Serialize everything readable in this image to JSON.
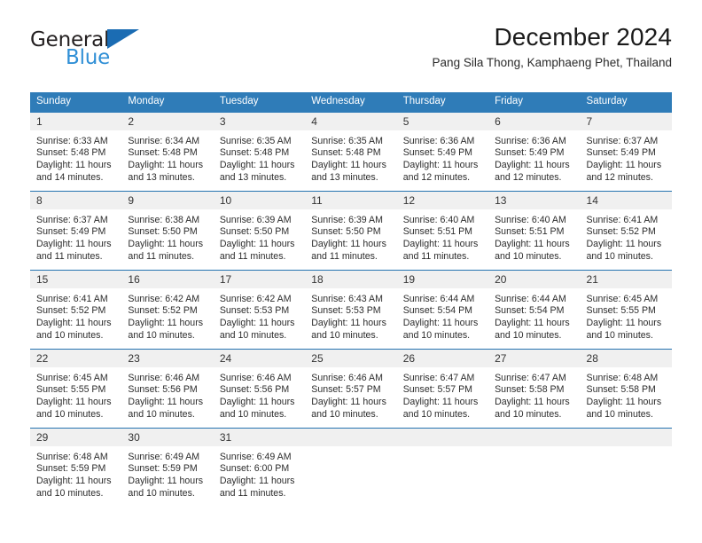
{
  "brand": {
    "name_part1": "General",
    "name_part2": "Blue",
    "triangle_color": "#1b6cb3",
    "blue_text_color": "#2f8fd6"
  },
  "header": {
    "title": "December 2024",
    "subtitle": "Pang Sila Thong, Kamphaeng Phet, Thailand"
  },
  "theme": {
    "header_blue": "#2f7cb8",
    "separator_blue": "#2573b0",
    "daynum_band": "#f0f0f0"
  },
  "weekdays": [
    "Sunday",
    "Monday",
    "Tuesday",
    "Wednesday",
    "Thursday",
    "Friday",
    "Saturday"
  ],
  "weeks": [
    [
      {
        "day": "1",
        "sunrise": "Sunrise: 6:33 AM",
        "sunset": "Sunset: 5:48 PM",
        "daylight": "Daylight: 11 hours and 14 minutes."
      },
      {
        "day": "2",
        "sunrise": "Sunrise: 6:34 AM",
        "sunset": "Sunset: 5:48 PM",
        "daylight": "Daylight: 11 hours and 13 minutes."
      },
      {
        "day": "3",
        "sunrise": "Sunrise: 6:35 AM",
        "sunset": "Sunset: 5:48 PM",
        "daylight": "Daylight: 11 hours and 13 minutes."
      },
      {
        "day": "4",
        "sunrise": "Sunrise: 6:35 AM",
        "sunset": "Sunset: 5:48 PM",
        "daylight": "Daylight: 11 hours and 13 minutes."
      },
      {
        "day": "5",
        "sunrise": "Sunrise: 6:36 AM",
        "sunset": "Sunset: 5:49 PM",
        "daylight": "Daylight: 11 hours and 12 minutes."
      },
      {
        "day": "6",
        "sunrise": "Sunrise: 6:36 AM",
        "sunset": "Sunset: 5:49 PM",
        "daylight": "Daylight: 11 hours and 12 minutes."
      },
      {
        "day": "7",
        "sunrise": "Sunrise: 6:37 AM",
        "sunset": "Sunset: 5:49 PM",
        "daylight": "Daylight: 11 hours and 12 minutes."
      }
    ],
    [
      {
        "day": "8",
        "sunrise": "Sunrise: 6:37 AM",
        "sunset": "Sunset: 5:49 PM",
        "daylight": "Daylight: 11 hours and 11 minutes."
      },
      {
        "day": "9",
        "sunrise": "Sunrise: 6:38 AM",
        "sunset": "Sunset: 5:50 PM",
        "daylight": "Daylight: 11 hours and 11 minutes."
      },
      {
        "day": "10",
        "sunrise": "Sunrise: 6:39 AM",
        "sunset": "Sunset: 5:50 PM",
        "daylight": "Daylight: 11 hours and 11 minutes."
      },
      {
        "day": "11",
        "sunrise": "Sunrise: 6:39 AM",
        "sunset": "Sunset: 5:50 PM",
        "daylight": "Daylight: 11 hours and 11 minutes."
      },
      {
        "day": "12",
        "sunrise": "Sunrise: 6:40 AM",
        "sunset": "Sunset: 5:51 PM",
        "daylight": "Daylight: 11 hours and 11 minutes."
      },
      {
        "day": "13",
        "sunrise": "Sunrise: 6:40 AM",
        "sunset": "Sunset: 5:51 PM",
        "daylight": "Daylight: 11 hours and 10 minutes."
      },
      {
        "day": "14",
        "sunrise": "Sunrise: 6:41 AM",
        "sunset": "Sunset: 5:52 PM",
        "daylight": "Daylight: 11 hours and 10 minutes."
      }
    ],
    [
      {
        "day": "15",
        "sunrise": "Sunrise: 6:41 AM",
        "sunset": "Sunset: 5:52 PM",
        "daylight": "Daylight: 11 hours and 10 minutes."
      },
      {
        "day": "16",
        "sunrise": "Sunrise: 6:42 AM",
        "sunset": "Sunset: 5:52 PM",
        "daylight": "Daylight: 11 hours and 10 minutes."
      },
      {
        "day": "17",
        "sunrise": "Sunrise: 6:42 AM",
        "sunset": "Sunset: 5:53 PM",
        "daylight": "Daylight: 11 hours and 10 minutes."
      },
      {
        "day": "18",
        "sunrise": "Sunrise: 6:43 AM",
        "sunset": "Sunset: 5:53 PM",
        "daylight": "Daylight: 11 hours and 10 minutes."
      },
      {
        "day": "19",
        "sunrise": "Sunrise: 6:44 AM",
        "sunset": "Sunset: 5:54 PM",
        "daylight": "Daylight: 11 hours and 10 minutes."
      },
      {
        "day": "20",
        "sunrise": "Sunrise: 6:44 AM",
        "sunset": "Sunset: 5:54 PM",
        "daylight": "Daylight: 11 hours and 10 minutes."
      },
      {
        "day": "21",
        "sunrise": "Sunrise: 6:45 AM",
        "sunset": "Sunset: 5:55 PM",
        "daylight": "Daylight: 11 hours and 10 minutes."
      }
    ],
    [
      {
        "day": "22",
        "sunrise": "Sunrise: 6:45 AM",
        "sunset": "Sunset: 5:55 PM",
        "daylight": "Daylight: 11 hours and 10 minutes."
      },
      {
        "day": "23",
        "sunrise": "Sunrise: 6:46 AM",
        "sunset": "Sunset: 5:56 PM",
        "daylight": "Daylight: 11 hours and 10 minutes."
      },
      {
        "day": "24",
        "sunrise": "Sunrise: 6:46 AM",
        "sunset": "Sunset: 5:56 PM",
        "daylight": "Daylight: 11 hours and 10 minutes."
      },
      {
        "day": "25",
        "sunrise": "Sunrise: 6:46 AM",
        "sunset": "Sunset: 5:57 PM",
        "daylight": "Daylight: 11 hours and 10 minutes."
      },
      {
        "day": "26",
        "sunrise": "Sunrise: 6:47 AM",
        "sunset": "Sunset: 5:57 PM",
        "daylight": "Daylight: 11 hours and 10 minutes."
      },
      {
        "day": "27",
        "sunrise": "Sunrise: 6:47 AM",
        "sunset": "Sunset: 5:58 PM",
        "daylight": "Daylight: 11 hours and 10 minutes."
      },
      {
        "day": "28",
        "sunrise": "Sunrise: 6:48 AM",
        "sunset": "Sunset: 5:58 PM",
        "daylight": "Daylight: 11 hours and 10 minutes."
      }
    ],
    [
      {
        "day": "29",
        "sunrise": "Sunrise: 6:48 AM",
        "sunset": "Sunset: 5:59 PM",
        "daylight": "Daylight: 11 hours and 10 minutes."
      },
      {
        "day": "30",
        "sunrise": "Sunrise: 6:49 AM",
        "sunset": "Sunset: 5:59 PM",
        "daylight": "Daylight: 11 hours and 10 minutes."
      },
      {
        "day": "31",
        "sunrise": "Sunrise: 6:49 AM",
        "sunset": "Sunset: 6:00 PM",
        "daylight": "Daylight: 11 hours and 11 minutes."
      },
      {
        "day": "",
        "sunrise": "",
        "sunset": "",
        "daylight": ""
      },
      {
        "day": "",
        "sunrise": "",
        "sunset": "",
        "daylight": ""
      },
      {
        "day": "",
        "sunrise": "",
        "sunset": "",
        "daylight": ""
      },
      {
        "day": "",
        "sunrise": "",
        "sunset": "",
        "daylight": ""
      }
    ]
  ]
}
